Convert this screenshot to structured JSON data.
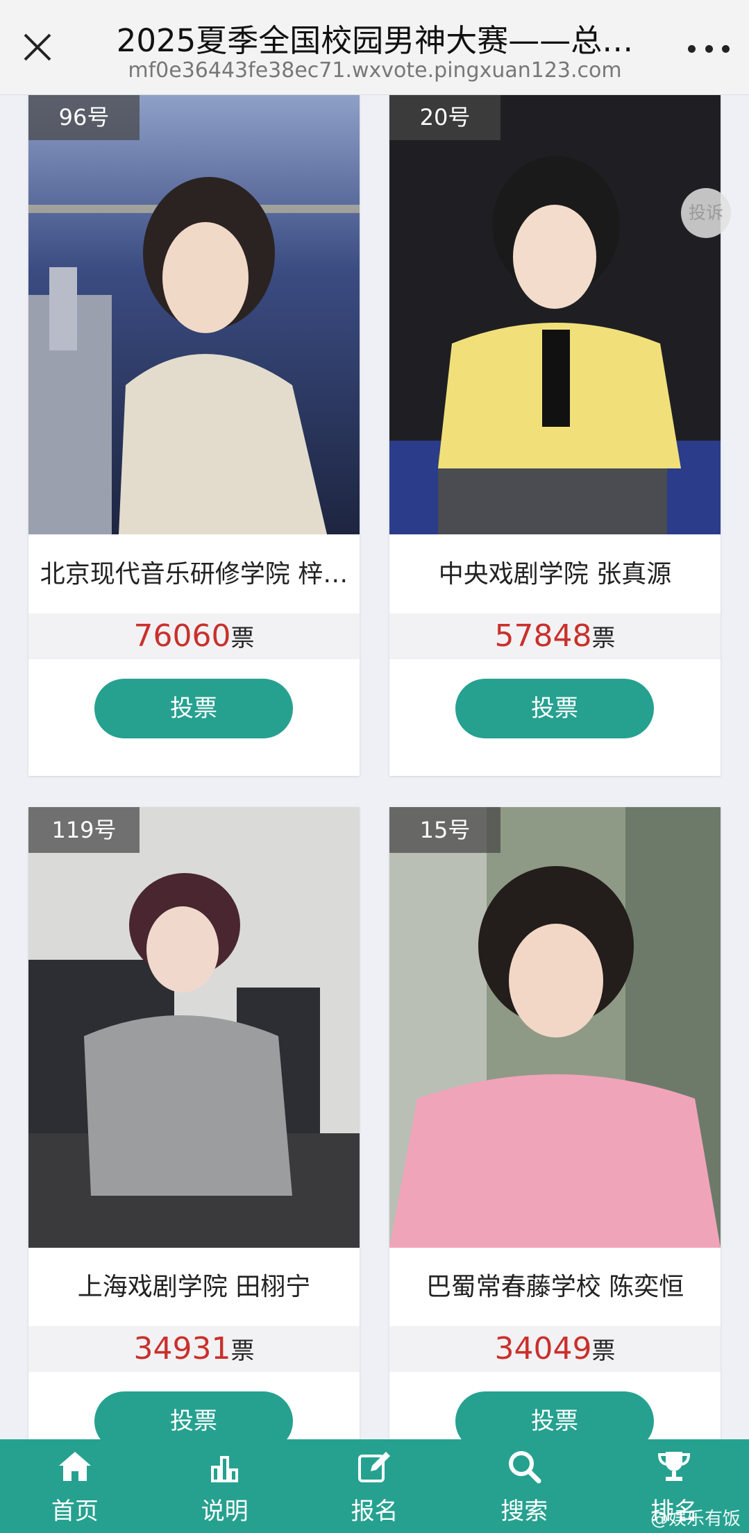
{
  "header": {
    "title": "2025夏季全国校园男神大赛——总…",
    "url": "mf0e36443fe38ec71.wxvote.pingxuan123.com"
  },
  "complaint_label": "投诉",
  "vote_unit": "票",
  "vote_button": "投票",
  "cards": [
    {
      "badge": "96号",
      "name": "北京现代音乐研修学院 梓…",
      "votes": "76060"
    },
    {
      "badge": "20号",
      "name": "中央戏剧学院 张真源",
      "votes": "57848"
    },
    {
      "badge": "119号",
      "name": "上海戏剧学院 田栩宁",
      "votes": "34931"
    },
    {
      "badge": "15号",
      "name": "巴蜀常春藤学校 陈奕恒",
      "votes": "34049"
    }
  ],
  "nav": [
    {
      "label": "首页",
      "icon": "home-icon"
    },
    {
      "label": "说明",
      "icon": "bar-chart-icon"
    },
    {
      "label": "报名",
      "icon": "edit-icon"
    },
    {
      "label": "搜索",
      "icon": "search-icon"
    },
    {
      "label": "排名",
      "icon": "trophy-icon"
    }
  ],
  "watermark": "@娱乐有饭",
  "colors": {
    "accent": "#26a190",
    "votes": "#c9302c"
  }
}
